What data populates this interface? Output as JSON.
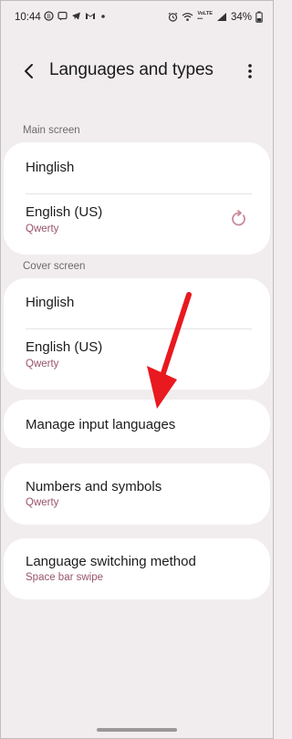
{
  "status_bar": {
    "time": "10:44",
    "left_icons": [
      "data-saver-icon",
      "message-icon",
      "telegram-icon",
      "gmail-icon",
      "dot-icon"
    ],
    "right_icons": [
      "alarm-icon",
      "wifi-icon",
      "volte-lte-icon",
      "signal-icon"
    ],
    "volte_label": "VoLTE",
    "battery": "34%"
  },
  "header": {
    "title": "Languages and types"
  },
  "main_screen": {
    "label": "Main screen",
    "items": [
      {
        "title": "Hinglish"
      },
      {
        "title": "English (US)",
        "subtitle": "Qwerty"
      }
    ]
  },
  "cover_screen": {
    "label": "Cover screen",
    "items": [
      {
        "title": "Hinglish"
      },
      {
        "title": "English (US)",
        "subtitle": "Qwerty"
      }
    ]
  },
  "manage_input": {
    "title": "Manage input languages"
  },
  "numbers_symbols": {
    "title": "Numbers and symbols",
    "subtitle": "Qwerty"
  },
  "language_switching": {
    "title": "Language switching method",
    "subtitle": "Space bar swipe"
  },
  "colors": {
    "background": "#f1edee",
    "card": "#ffffff",
    "accent_subtitle": "#98546a",
    "annotation_arrow": "#e8191f",
    "reset_icon": "#c98a99"
  }
}
